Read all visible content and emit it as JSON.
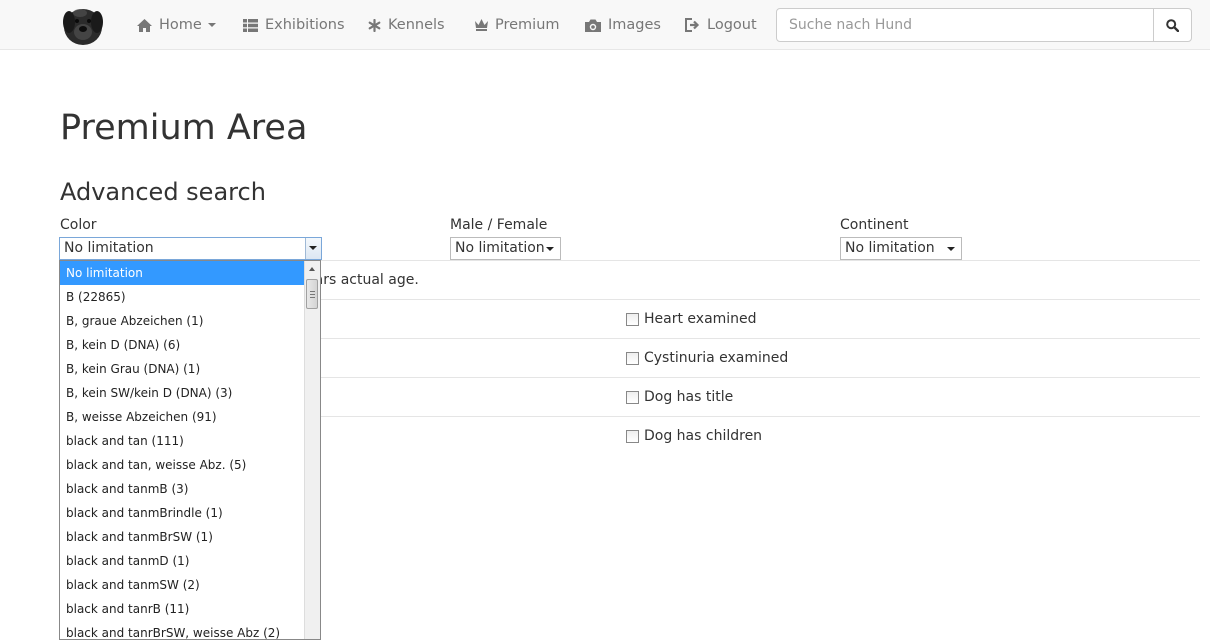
{
  "navbar": {
    "items": [
      {
        "label": "Home",
        "icon": "home-icon"
      },
      {
        "label": "Exhibitions",
        "icon": "th-list-icon"
      },
      {
        "label": "Kennels",
        "icon": "asterisk-icon"
      },
      {
        "label": "Premium",
        "icon": "crown-icon"
      },
      {
        "label": "Images",
        "icon": "camera-icon"
      },
      {
        "label": "Logout",
        "icon": "logout-icon"
      }
    ],
    "search_placeholder": "Suche nach Hund"
  },
  "page": {
    "title": "Premium Area",
    "section_title": "Advanced search"
  },
  "filters": {
    "color": {
      "label": "Color",
      "value": "No limitation"
    },
    "sex": {
      "label": "Male / Female",
      "value": "No limitation"
    },
    "continent": {
      "label": "Continent",
      "value": "No limitation"
    }
  },
  "row_text_partial": "ears actual age.",
  "checkboxes": [
    {
      "label": "Heart examined",
      "checked": false
    },
    {
      "label": "Cystinuria examined",
      "checked": false
    },
    {
      "label": "Dog has title",
      "checked": false
    },
    {
      "label": "Dog has children",
      "checked": false
    }
  ],
  "color_dropdown": {
    "selected_index": 0,
    "options": [
      "No limitation",
      "B (22865)",
      "B, graue Abzeichen (1)",
      "B, kein D (DNA) (6)",
      "B, kein Grau (DNA) (1)",
      "B, kein SW/kein D (DNA) (3)",
      "B, weisse Abzeichen (91)",
      "black and tan (111)",
      "black and tan, weisse Abz. (5)",
      "black and tanmB (3)",
      "black and tanmBrindle (1)",
      "black and tanmBrSW (1)",
      "black and tanmD (1)",
      "black and tanmSW (2)",
      "black and tanrB (11)",
      "black and tanrBrSW, weisse Abz (2)"
    ]
  },
  "colors": {
    "navbar_bg": "#f8f8f8",
    "nav_text": "#777777",
    "selected_option_bg": "#3399ff"
  }
}
